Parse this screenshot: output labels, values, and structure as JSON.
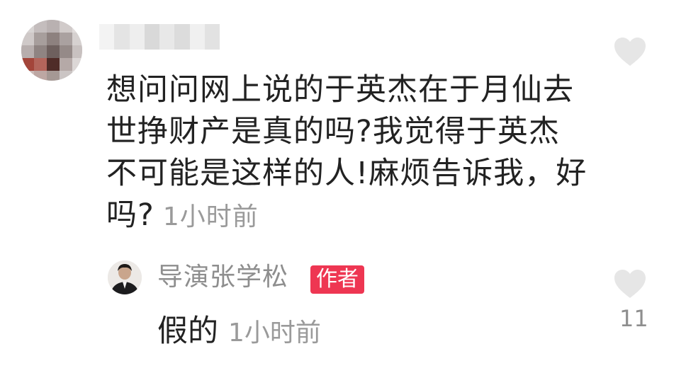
{
  "comment": {
    "text": "想问问网上说的于英杰在于月仙去世挣财产是真的吗?我觉得于英杰不可能是这样的人!麻烦告诉我，好吗?",
    "time": "1小时前",
    "heart_icon": "heart-icon"
  },
  "reply": {
    "name": "导演张学松",
    "badge": "作者",
    "text": "假的",
    "time": "1小时前",
    "like_count": "11",
    "heart_icon": "heart-icon"
  },
  "colors": {
    "text": "#222222",
    "muted": "#9a9a9a",
    "heart": "#e6e6e6",
    "badge": "#ee3652"
  }
}
